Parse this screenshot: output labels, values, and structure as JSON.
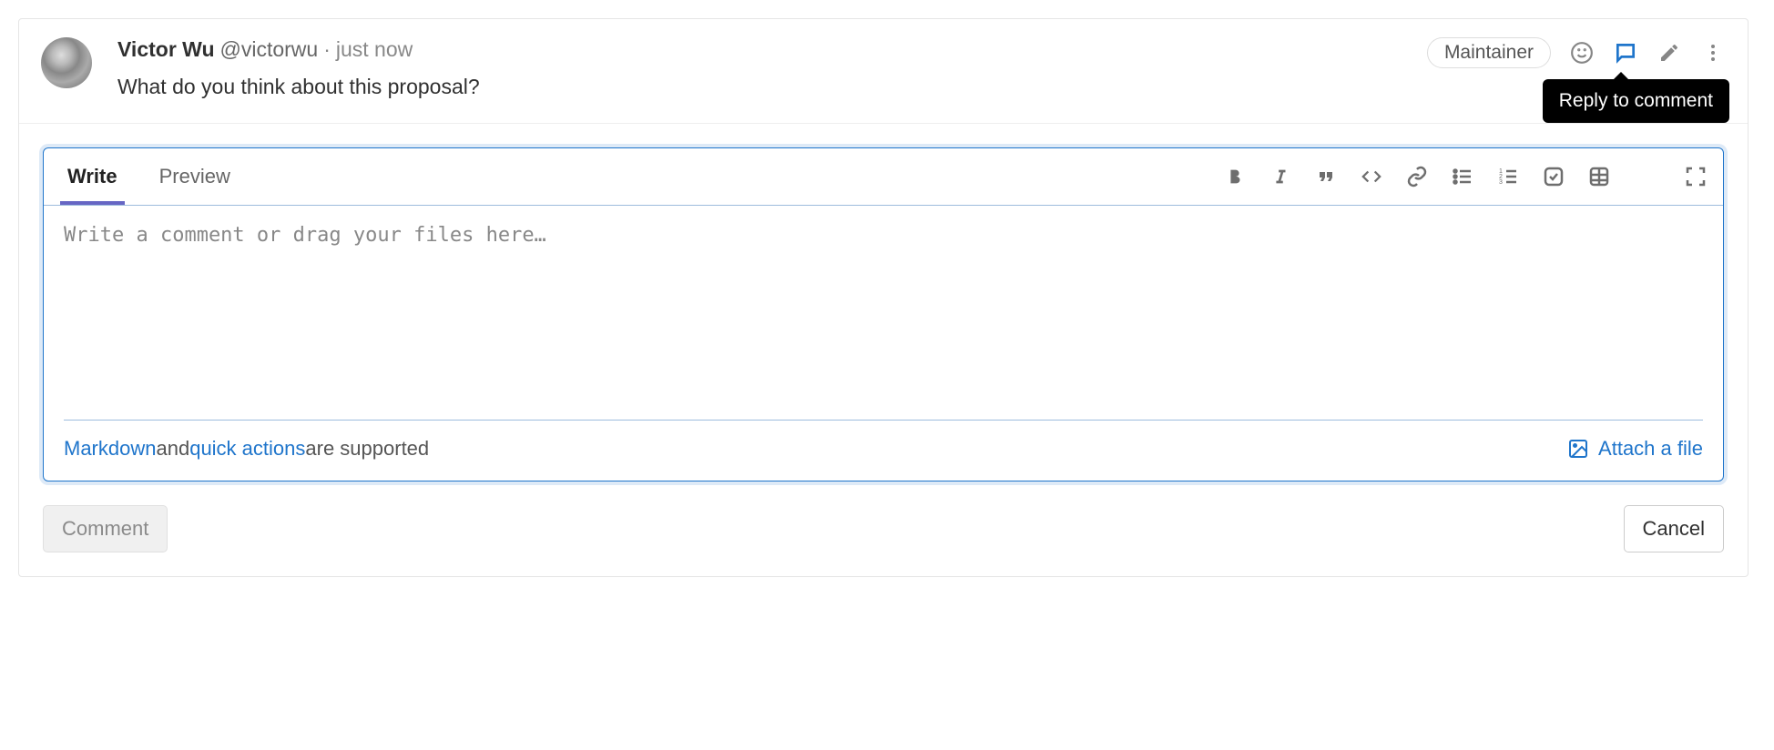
{
  "comment": {
    "author_name": "Victor Wu",
    "author_handle": "@victorwu",
    "separator": "·",
    "timestamp": "just now",
    "role_badge": "Maintainer",
    "body": "What do you think about this proposal?",
    "tooltip_reply": "Reply to comment"
  },
  "editor": {
    "tabs": {
      "write": "Write",
      "preview": "Preview"
    },
    "placeholder": "Write a comment or drag your files here…",
    "value": "",
    "footer": {
      "markdown_link": "Markdown",
      "plain1": " and ",
      "quick_actions_link": "quick actions",
      "plain2": " are supported",
      "attach": "Attach a file"
    }
  },
  "buttons": {
    "comment": "Comment",
    "cancel": "Cancel"
  }
}
